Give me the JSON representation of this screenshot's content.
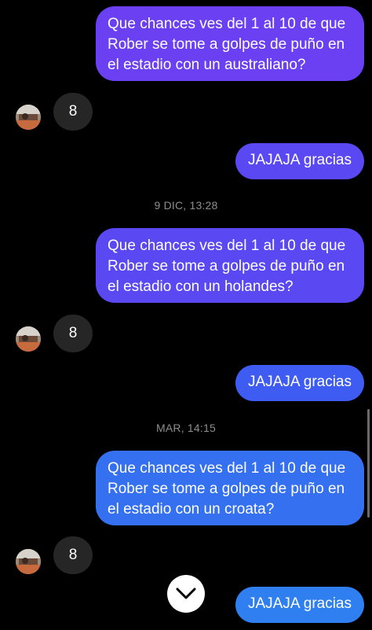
{
  "messages": [
    {
      "type": "sent",
      "text": "Que chances ves del 1 al 10 de que\nRober se tome a golpes de puño en\nel estadio con un australiano?",
      "color": "#6a40f2"
    },
    {
      "type": "received",
      "text": "8"
    },
    {
      "type": "sent",
      "text": "JAJAJA gracias",
      "color": "#5a48f2"
    },
    {
      "type": "timestamp",
      "text": "9 DIC, 13:28"
    },
    {
      "type": "sent",
      "text": "Que chances ves del 1 al 10 de que\nRober se tome a golpes de puño en\nel estadio con un holandes?",
      "color": "#5a48f2"
    },
    {
      "type": "received",
      "text": "8"
    },
    {
      "type": "sent",
      "text": "JAJAJA gracias",
      "color": "#3f5cf2"
    },
    {
      "type": "timestamp",
      "text": "MAR, 14:15"
    },
    {
      "type": "sent",
      "text": "Que chances ves del 1 al 10 de que\nRober se tome a golpes de puño en\nel estadio con un croata?",
      "color": "#3470f0"
    },
    {
      "type": "received",
      "text": "8"
    },
    {
      "type": "sent",
      "text": "JAJAJA gracias",
      "color": "#2f7ff0"
    }
  ],
  "controls": {
    "scroll_down_icon": "chevron-down-icon"
  },
  "colors": {
    "background": "#000000",
    "received_bubble": "#262626",
    "timestamp": "#8e8e8e"
  }
}
